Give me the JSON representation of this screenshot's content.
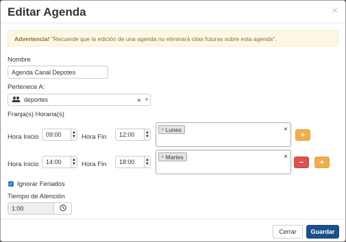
{
  "modal": {
    "title": "Editar Agenda",
    "close_glyph": "×"
  },
  "alert": {
    "strong": "Advertencia!",
    "text": " \"Recuerde que la edición de una agenda no eliminará citas futuras sobre esta agenda\"."
  },
  "form": {
    "nombre_label": "Nombre",
    "nombre_value": "Agenda Canal Depotes",
    "pertenece_label": "Pertenece A:",
    "pertenece_value": "deportes",
    "franjas_label": "Franja(s) Horaria(s)",
    "franjas": [
      {
        "inicio_label": "Hora Inicio",
        "inicio_value": "09:00",
        "fin_label": "Hora Fin",
        "fin_value": "12:00",
        "day": "Lunes",
        "add_label": "+"
      },
      {
        "inicio_label": "Hora Inicio",
        "inicio_value": "14:00",
        "fin_label": "Hora Fin",
        "fin_value": "18:00",
        "day": "Martes",
        "remove_label": "−",
        "add_label": "+"
      }
    ],
    "ignorar_label": "Ignorar Feriados",
    "ignorar_checked": true,
    "tiempo_label": "Tiempo de Atención",
    "tiempo_value": "1:00"
  },
  "footer": {
    "cerrar_label": "Cerrar",
    "guardar_label": "Guardar"
  },
  "colors": {
    "primary": "#1c4f8b",
    "warning": "#f0ad4e",
    "danger": "#d9534f",
    "alert_bg": "#fcf8e3"
  }
}
